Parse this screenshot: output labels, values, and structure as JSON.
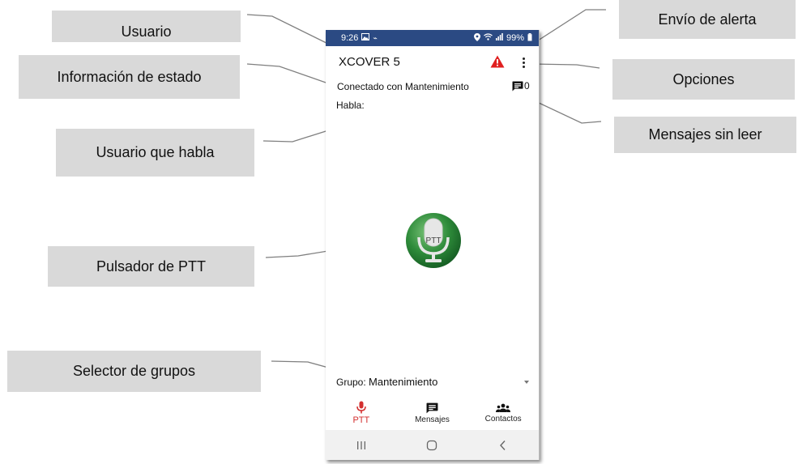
{
  "callouts": {
    "usuario": "Usuario",
    "info_estado": "Información de estado",
    "usuario_habla": "Usuario que habla",
    "pulsador_ptt": "Pulsador de PTT",
    "selector_grupos": "Selector de grupos",
    "envio_alerta": "Envío de alerta",
    "opciones": "Opciones",
    "mensajes_sin_leer": "Mensajes sin leer"
  },
  "phone": {
    "status_bar": {
      "time": "9:26",
      "battery": "99%"
    },
    "app_title": "XCOVER 5",
    "status_text": "Conectado con Mantenimiento",
    "unread_count": "0",
    "speaker_label": "Habla:",
    "ptt_label": "PTT",
    "group": {
      "label": "Grupo:",
      "value": "Mantenimiento"
    },
    "tabs": [
      {
        "label": "PTT",
        "icon": "mic-icon",
        "active": true
      },
      {
        "label": "Mensajes",
        "icon": "message-icon",
        "active": false
      },
      {
        "label": "Contactos",
        "icon": "contacts-icon",
        "active": false
      }
    ],
    "nav_buttons": [
      "recents-icon",
      "home-icon",
      "back-icon"
    ]
  },
  "colors": {
    "status_bar": "#2b4a83",
    "alert": "#e02020",
    "active_tab": "#d32f2f",
    "ptt_green": "#2e7d32",
    "callout_bg": "#d9d9d9"
  }
}
